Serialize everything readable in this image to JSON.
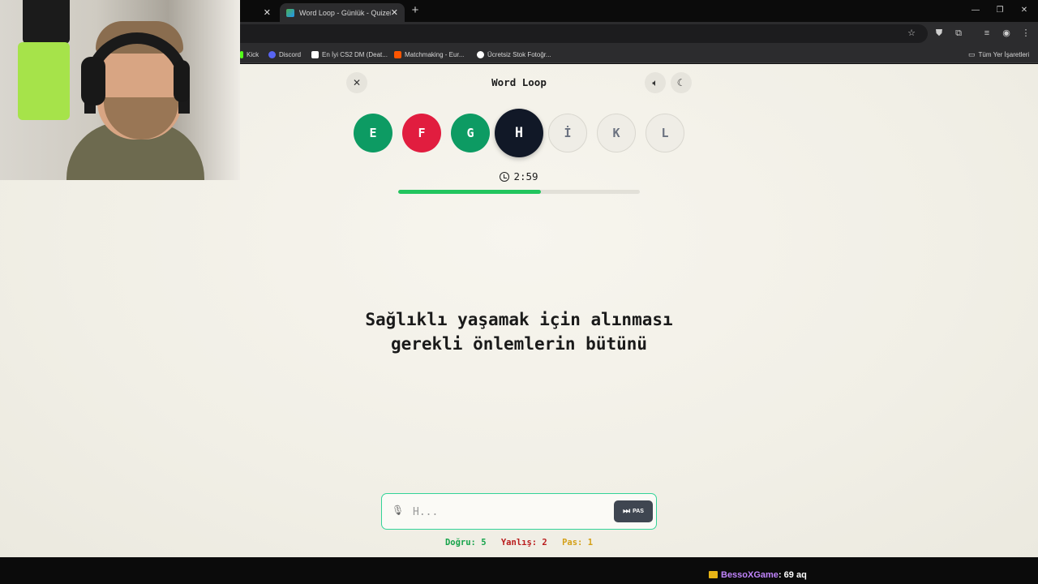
{
  "browser": {
    "tabs": [
      {
        "title": "",
        "active": false
      },
      {
        "title": "Word Loop - Günlük - Quizei",
        "active": true
      }
    ],
    "bookmarks": [
      {
        "label": "Kick",
        "icon": "kick-icon",
        "color": "#53fc18"
      },
      {
        "label": "Discord",
        "icon": "discord-icon",
        "color": "#5865f2"
      },
      {
        "label": "En İyi CS2 DM (Deat...",
        "icon": "cs2-icon",
        "color": "#ffffff"
      },
      {
        "label": "Matchmaking - Eur...",
        "icon": "faceit-icon",
        "color": "#ff5500"
      },
      {
        "label": "Ücretsiz Stok Fotoğr...",
        "icon": "pexels-icon",
        "color": "#ffffff"
      }
    ],
    "all_bookmarks_label": "Tüm Yer İşaretleri"
  },
  "game": {
    "title": "Word Loop",
    "letters": [
      {
        "char": "E",
        "state": "correct"
      },
      {
        "char": "F",
        "state": "wrong"
      },
      {
        "char": "G",
        "state": "correct"
      },
      {
        "char": "H",
        "state": "current"
      },
      {
        "char": "İ",
        "state": "pending"
      },
      {
        "char": "K",
        "state": "pending"
      },
      {
        "char": "L",
        "state": "pending"
      }
    ],
    "timer": "2:59",
    "time_progress": 0.59,
    "question": "Sağlıklı yaşamak için alınması gerekli önlemlerin bütünü",
    "answer_placeholder": "H...",
    "pass_label": "PAS",
    "stats": {
      "correct": "Doğru: 5",
      "wrong": "Yanlış: 2",
      "pass": "Pas: 1"
    },
    "colors": {
      "correct": "#0d9b63",
      "wrong": "#e11d3f",
      "current": "#111827",
      "progress": "#22c55e"
    }
  },
  "stream_overlay": {
    "user": "BessoXGame",
    "message": ": 69 aq"
  }
}
